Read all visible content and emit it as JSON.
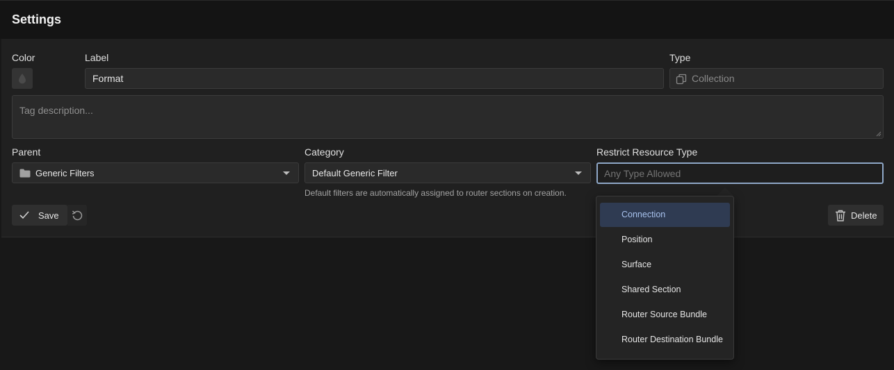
{
  "header": {
    "title": "Settings"
  },
  "form": {
    "color_label": "Color",
    "label_label": "Label",
    "label_value": "Format",
    "type_label": "Type",
    "type_value": "Collection",
    "description_placeholder": "Tag description...",
    "parent_label": "Parent",
    "parent_value": "Generic Filters",
    "category_label": "Category",
    "category_value": "Default Generic Filter",
    "category_hint": "Default filters are automatically assigned to router sections on creation.",
    "restrict_label": "Restrict Resource Type",
    "restrict_placeholder": "Any Type Allowed"
  },
  "actions": {
    "save_label": "Save",
    "delete_label": "Delete"
  },
  "dropdown": {
    "selected": "Connection",
    "options": [
      {
        "label": "Connection"
      },
      {
        "label": "Position"
      },
      {
        "label": "Surface"
      },
      {
        "label": "Shared Section"
      },
      {
        "label": "Router Source Bundle"
      },
      {
        "label": "Router Destination Bundle"
      }
    ]
  },
  "colors": {
    "focus_border": "#8fa8c8",
    "selected_option_bg": "#2f3b52",
    "selected_option_text": "#a9c3ee"
  },
  "icons": {
    "color": "droplet-icon",
    "type": "collection-icon",
    "parent": "folder-icon",
    "save": "check-icon",
    "reset": "reset-icon",
    "delete": "trash-icon"
  }
}
